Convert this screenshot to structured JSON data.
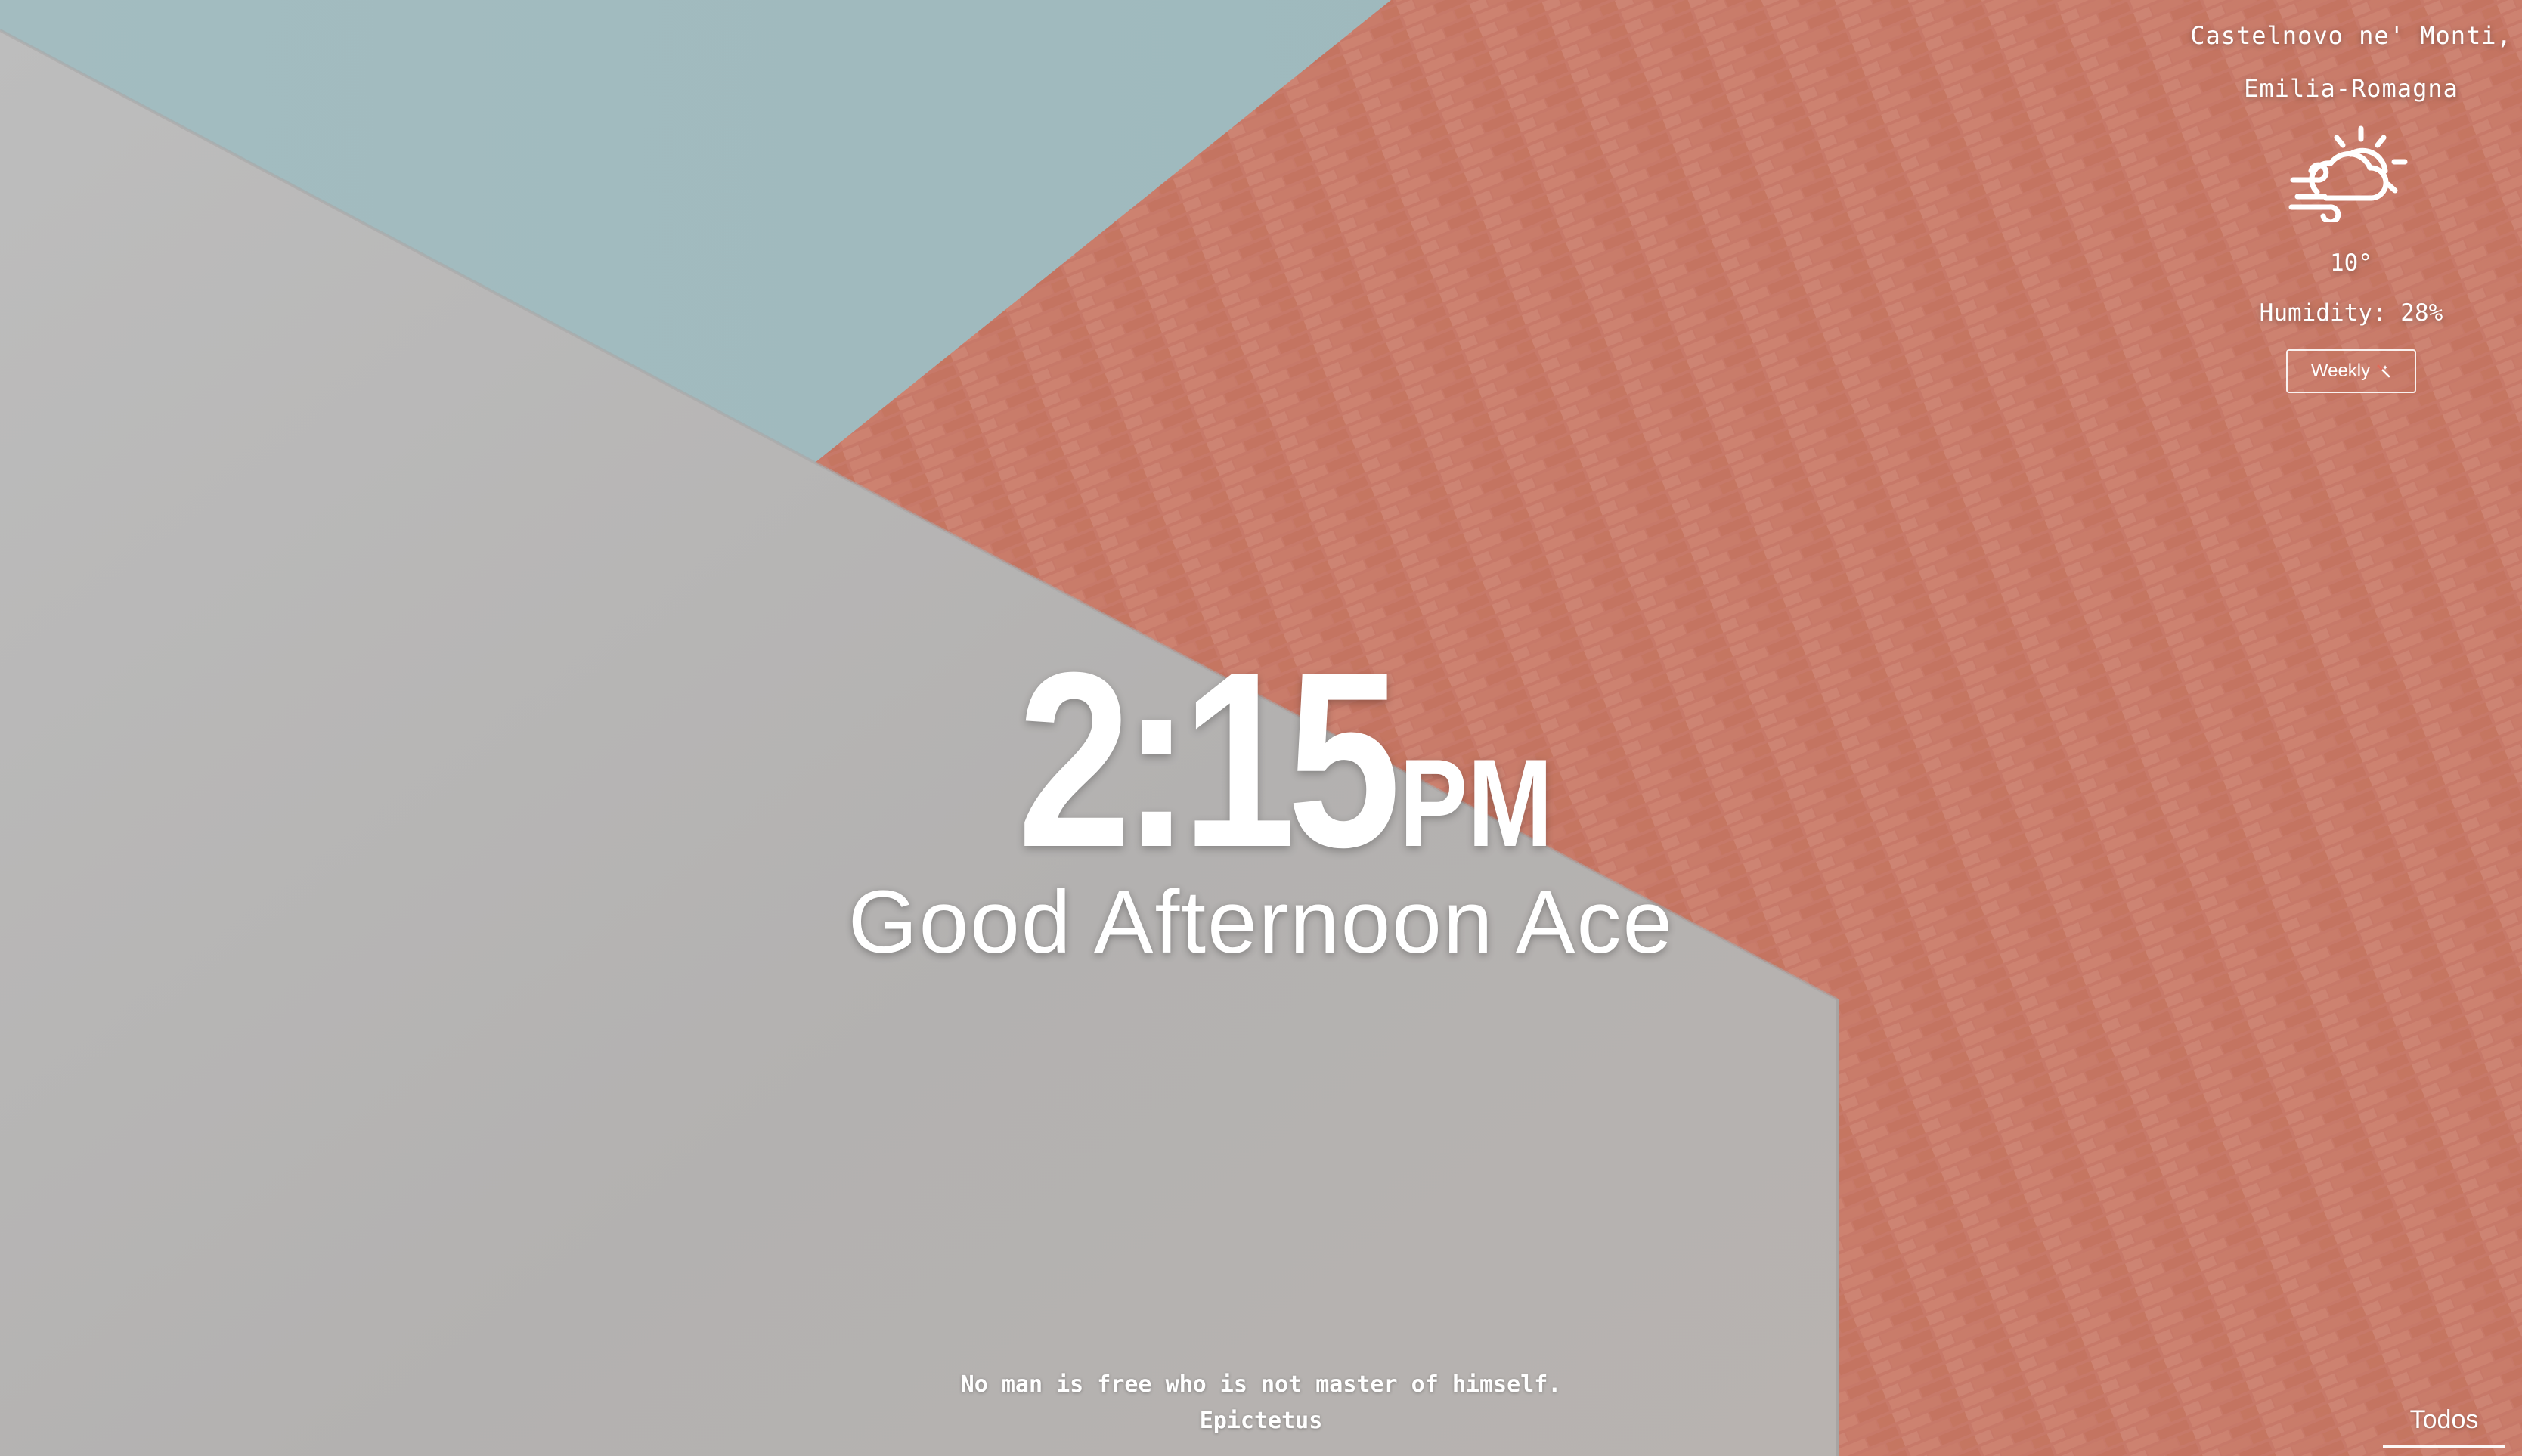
{
  "weather": {
    "location_line1": "Castelnovo ne' Monti,",
    "location_line2": "Emilia-Romagna",
    "icon": "cloud-sun-wind-icon",
    "temperature": "10°",
    "humidity": "Humidity: 28%",
    "weekly_button_label": "Weekly",
    "weekly_button_icon": "magic-wand-icon"
  },
  "clock": {
    "time": "2:15",
    "ampm": "PM"
  },
  "greeting": "Good Afternoon Ace",
  "quote": {
    "text": "No man is free who is not master of himself.",
    "author": "Epictetus"
  },
  "todos_label": "Todos",
  "colors": {
    "sky": "#9fb8bc",
    "brick": "#c97a67",
    "wall": "#b9b7b6",
    "text": "#ffffff"
  }
}
